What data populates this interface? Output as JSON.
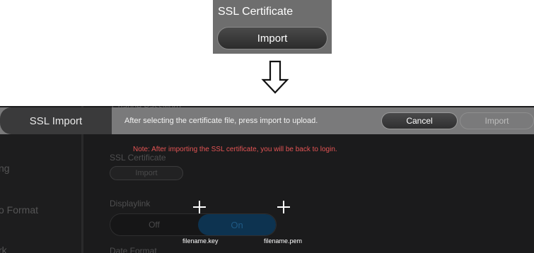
{
  "callout": {
    "title": "SSL Certificate",
    "button_label": "Import"
  },
  "background": {
    "left_items": [
      "ng",
      "o Format",
      "rk"
    ],
    "top_ghost": "Change Password",
    "ssl_label": "SSL Certificate",
    "import_label": "Import",
    "displaylink_label": "Displaylink",
    "toggle_off": "Off",
    "toggle_on": "On",
    "date_label": "Date Format"
  },
  "bar": {
    "title": "SSL Import",
    "message": "After selecting the certificate file, press import to upload.",
    "cancel_label": "Cancel",
    "import_label": "Import"
  },
  "note": "Note: After importing the SSL certificate, you will be back to login.",
  "files": [
    {
      "icon": "plus-icon",
      "label": "filename.key"
    },
    {
      "icon": "plus-icon",
      "label": "filename.pem"
    }
  ],
  "colors": {
    "note": "#e45454",
    "toggle_on": "#0d3350",
    "bar": "#7a7a7b",
    "panel": "#1b1b1c"
  }
}
